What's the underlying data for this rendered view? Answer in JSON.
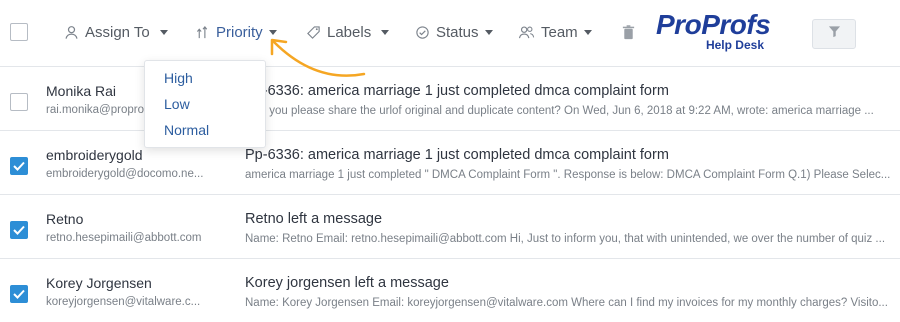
{
  "toolbar": {
    "assign_label": "Assign To",
    "priority_label": "Priority",
    "labels_label": "Labels",
    "status_label": "Status",
    "team_label": "Team",
    "icons": [
      "user-icon",
      "priority-icon",
      "tag-icon",
      "status-check-icon",
      "team-icon",
      "trash-icon",
      "filter-icon"
    ]
  },
  "logo": {
    "brand_part1": "Pro",
    "brand_part2": "Profs",
    "sub": "Help Desk"
  },
  "priority_dropdown": {
    "options": [
      "High",
      "Low",
      "Normal"
    ]
  },
  "accent_color": "#2d8ed6",
  "brand_color": "#1f3e9a",
  "arrow_color": "#f5a623",
  "tickets": [
    {
      "name": "Monika Rai",
      "email": "rai.monika@proprofs.com",
      "subject": "Pp-6336: america marriage 1 just completed dmca complaint form",
      "preview": "Can you please share the urlof original and duplicate content? On Wed, Jun 6, 2018 at 9:22 AM, wrote: america marriage ...",
      "checked": false
    },
    {
      "name": "embroiderygold",
      "email": "embroiderygold@docomo.ne...",
      "subject": "Pp-6336: america marriage 1 just completed dmca complaint form",
      "preview": "america marriage 1 just completed \" DMCA Complaint Form \". Response is below: DMCA Complaint Form Q.1) Please Selec...",
      "checked": true
    },
    {
      "name": "Retno",
      "email": "retno.hesepimaili@abbott.com",
      "subject": "Retno left a message",
      "preview": "Name: Retno Email: retno.hesepimaili@abbott.com Hi, Just to inform you, that with unintended, we over the number of quiz ...",
      "checked": true
    },
    {
      "name": "Korey Jorgensen",
      "email": "koreyjorgensen@vitalware.c...",
      "subject": "Korey jorgensen left a message",
      "preview": "Name: Korey Jorgensen Email: koreyjorgensen@vitalware.com Where can I find my invoices for my monthly charges? Visito...",
      "checked": true
    }
  ]
}
